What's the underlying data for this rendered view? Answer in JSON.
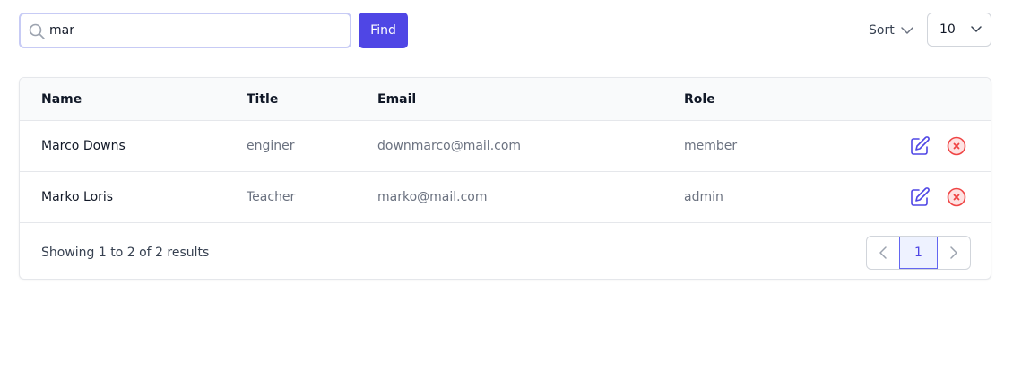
{
  "search": {
    "value": "mar",
    "button_label": "Find"
  },
  "toolbar": {
    "sort_label": "Sort",
    "page_size": "10"
  },
  "table": {
    "headers": {
      "name": "Name",
      "title": "Title",
      "email": "Email",
      "role": "Role"
    },
    "rows": [
      {
        "name": "Marco Downs",
        "title": "enginer",
        "email": "downmarco@mail.com",
        "role": "member"
      },
      {
        "name": "Marko Loris",
        "title": "Teacher",
        "email": "marko@mail.com",
        "role": "admin"
      }
    ]
  },
  "footer": {
    "summary": "Showing 1 to 2 of 2 results"
  },
  "pagination": {
    "current_page": "1"
  },
  "colors": {
    "accent": "#4f46e5",
    "danger": "#ef4444",
    "border": "#e5e7eb"
  },
  "icons": [
    "search-icon",
    "chevron-down-icon",
    "edit-icon",
    "delete-icon",
    "chevron-left-icon",
    "chevron-right-icon"
  ]
}
